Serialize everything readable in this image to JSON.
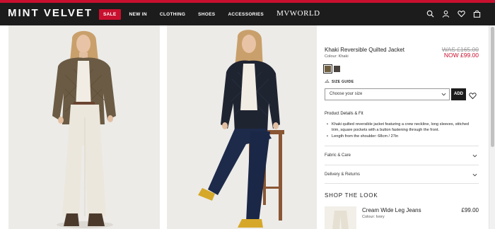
{
  "header": {
    "logo": "MINT VELVET",
    "nav": [
      "SALE",
      "NEW IN",
      "CLOTHING",
      "SHOES",
      "ACCESSORIES"
    ],
    "mvworld": "MVWORLD",
    "icons": [
      "search-icon",
      "account-icon",
      "wishlist-icon",
      "bag-icon"
    ]
  },
  "product": {
    "title": "Khaki Reversible Quilted Jacket",
    "colour": "Colour: Khaki",
    "was_price": "WAS £165.00",
    "now_price": "NOW £99.00",
    "swatches": [
      "#6e5d3e",
      "#4a4440"
    ],
    "size_guide": "SIZE GUIDE",
    "size_select_placeholder": "Choose your size",
    "add_label": "ADD",
    "details_heading": "Product Details & Fit",
    "details": [
      "Khaki quilted reversible jacket featuring a crew neckline, long sleeves, stitched trim, square pockets with a button fastening through the front.",
      "Length from the shoulder: 68cm / 27in"
    ],
    "accordions": [
      "Fabric & Care",
      "Delivery & Returns"
    ]
  },
  "shop_the_look": {
    "heading": "SHOP THE LOOK",
    "items": [
      {
        "name": "Cream Wide Leg Jeans",
        "colour": "Colour: Ivory",
        "price": "£99.00"
      }
    ]
  },
  "colors": {
    "accent": "#c8102e",
    "header_bg": "#1c1c1c"
  }
}
